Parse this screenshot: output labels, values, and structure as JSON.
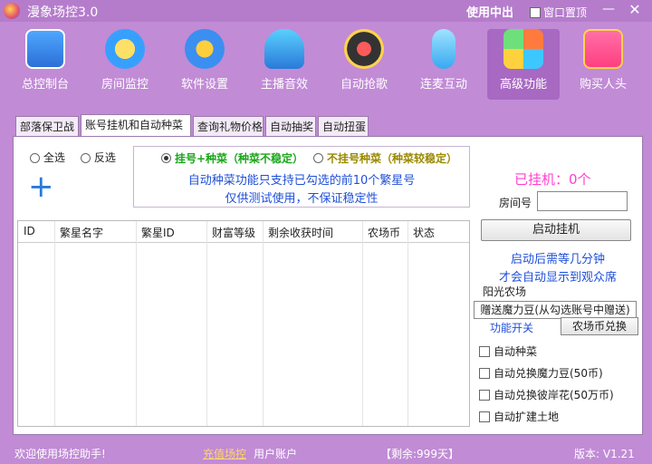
{
  "window": {
    "title": "漫象场控3.0",
    "help": "使用中出",
    "topmost_label": "窗口置顶",
    "minimize": "—",
    "close": "✕"
  },
  "toolbar": [
    {
      "label": "总控制台",
      "icon": "console-icon"
    },
    {
      "label": "房间监控",
      "icon": "room-monitor-icon"
    },
    {
      "label": "软件设置",
      "icon": "settings-icon"
    },
    {
      "label": "主播音效",
      "icon": "headphones-icon"
    },
    {
      "label": "自动抢歌",
      "icon": "record-icon"
    },
    {
      "label": "连麦互动",
      "icon": "microphone-icon"
    },
    {
      "label": "高级功能",
      "icon": "advanced-icon",
      "active": true
    },
    {
      "label": "购买人头",
      "icon": "gift-icon"
    }
  ],
  "tabs": [
    {
      "label": "部落保卫战"
    },
    {
      "label": "账号挂机和自动种菜",
      "selected": true
    },
    {
      "label": "查询礼物价格"
    },
    {
      "label": "自动抽奖"
    },
    {
      "label": "自动扭蛋"
    }
  ],
  "selection": {
    "all": "全选",
    "invert": "反选",
    "add": "+"
  },
  "mode": {
    "option1": "挂号+种菜（种菜不稳定）",
    "option2": "不挂号种菜（种菜较稳定）",
    "note1": "自动种菜功能只支持已勾选的前10个繁星号",
    "note2": "仅供测试使用，不保证稳定性"
  },
  "table": {
    "headers": [
      "ID",
      "繁星名字",
      "繁星ID",
      "财富等级",
      "剩余收获时间",
      "农场币",
      "状态"
    ]
  },
  "side": {
    "hung_status": "已挂机：0个",
    "room_label": "房间号",
    "room_value": "",
    "start_button": "启动挂机",
    "after_note1": "启动后需等几分钟",
    "after_note2": "才会自动显示到观众席"
  },
  "farm": {
    "title": "阳光农场",
    "bean_button": "赠送魔力豆(从勾选账号中赠送)",
    "func_switch": "功能开关",
    "coin_button": "农场币兑换",
    "options": [
      "自动种菜",
      "自动兑换魔力豆(50币)",
      "自动兑换彼岸花(50万币)",
      "自动扩建土地"
    ]
  },
  "status": {
    "welcome": "欢迎使用场控助手!",
    "recharge": "充值场控",
    "account": "用户账户",
    "remain": "【剩余:999天】",
    "version": "版本: V1.21"
  },
  "colors": {
    "background": "#c18bd6",
    "accent_blue": "#1f4fd8",
    "hung_pink": "#ff3fd0",
    "option_green": "#1aa61a",
    "option_olive": "#9a8a00"
  }
}
